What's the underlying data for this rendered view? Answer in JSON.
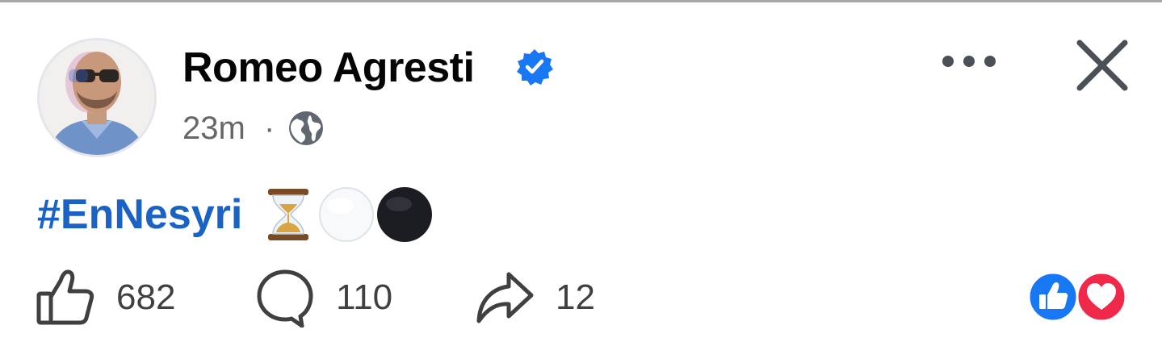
{
  "post": {
    "author": "Romeo Agresti",
    "verified_icon": "verified-badge-icon",
    "timestamp": "23m",
    "separator": "·",
    "audience_icon": "globe-icon",
    "hashtag": "#EnNesyri",
    "emojis": [
      "hourglass-emoji",
      "white-circle-emoji",
      "black-circle-emoji"
    ]
  },
  "header": {
    "more_icon": "more-horizontal-icon",
    "close_icon": "close-icon"
  },
  "actions": {
    "likes": "682",
    "comments": "110",
    "shares": "12"
  },
  "reactions": [
    "like-reaction-icon",
    "love-reaction-icon"
  ],
  "colors": {
    "brand_blue": "#1877f2",
    "hashtag_blue": "#1a63c4",
    "love_red": "#f02849",
    "secondary_text": "#65676b"
  }
}
